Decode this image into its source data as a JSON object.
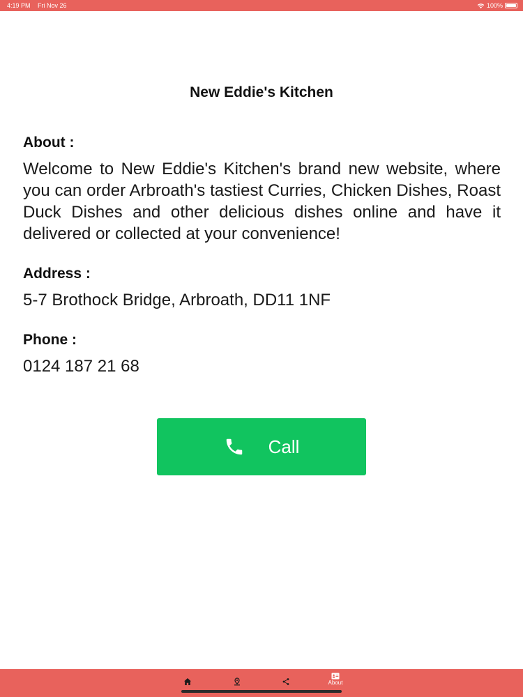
{
  "status_bar": {
    "time": "4:19 PM",
    "date": "Fri Nov 26",
    "battery": "100%"
  },
  "restaurant": {
    "name": "New Eddie's Kitchen"
  },
  "about": {
    "label": "About :",
    "text": "Welcome to New Eddie's Kitchen's brand new website, where you can order Arbroath's tastiest Curries, Chicken Dishes, Roast Duck Dishes and other delicious dishes online and have it delivered or collected at your convenience!"
  },
  "address": {
    "label": "Address :",
    "value": "5-7 Brothock Bridge, Arbroath, DD11 1NF"
  },
  "phone": {
    "label": "Phone :",
    "value": "0124 187 21 68"
  },
  "call_button": {
    "label": "Call",
    "icon": "phone-icon",
    "color": "#11c45f"
  },
  "tab_bar": {
    "color": "#e8625c",
    "tabs": [
      {
        "icon": "home-icon"
      },
      {
        "icon": "location-icon"
      },
      {
        "icon": "share-icon"
      },
      {
        "icon": "about-icon",
        "label": "About"
      }
    ]
  }
}
